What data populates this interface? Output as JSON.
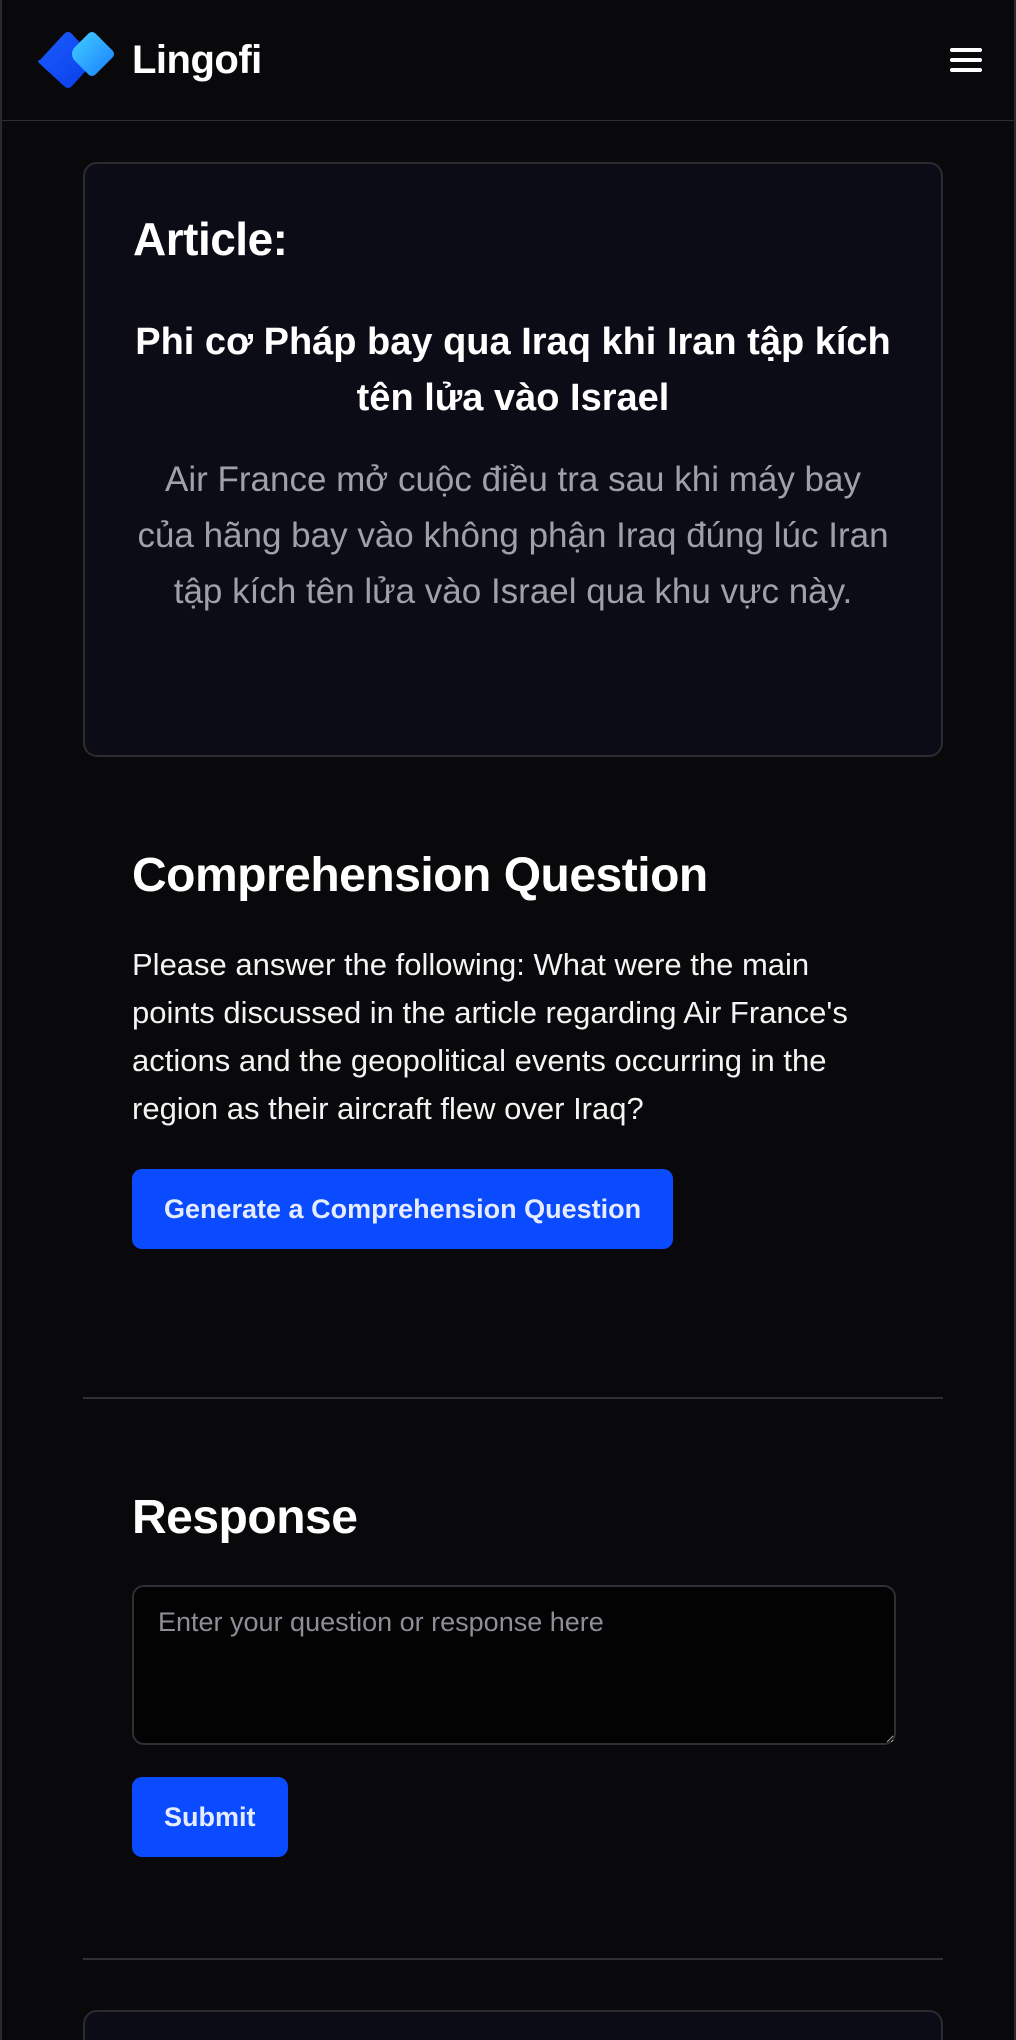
{
  "header": {
    "brand_name": "Lingofi",
    "logo_icon": "diamond-logo-icon",
    "menu_icon": "hamburger-menu-icon",
    "colors": {
      "logo_primary": "#1a5cff",
      "logo_secondary": "#2ab4ff"
    }
  },
  "article": {
    "label": "Article:",
    "title": "Phi cơ Pháp bay qua Iraq khi Iran tập kích tên lửa vào Israel",
    "summary": "Air France mở cuộc điều tra sau khi máy bay của hãng bay vào không phận Iraq đúng lúc Iran tập kích tên lửa vào Israel qua khu vực này."
  },
  "comprehension": {
    "title": "Comprehension Question",
    "question": "Please answer the following: What were the main points discussed in the article regarding Air France's actions and the geopolitical events occurring in the region as their aircraft flew over Iraq?",
    "generate_label": "Generate a Comprehension Question"
  },
  "response": {
    "title": "Response",
    "placeholder": "Enter your question or response here",
    "value": "",
    "submit_label": "Submit"
  },
  "colors": {
    "background": "#09090b",
    "card": "#0b0c16",
    "accent": "#0b4bff",
    "muted_text": "#9ea0aa"
  }
}
